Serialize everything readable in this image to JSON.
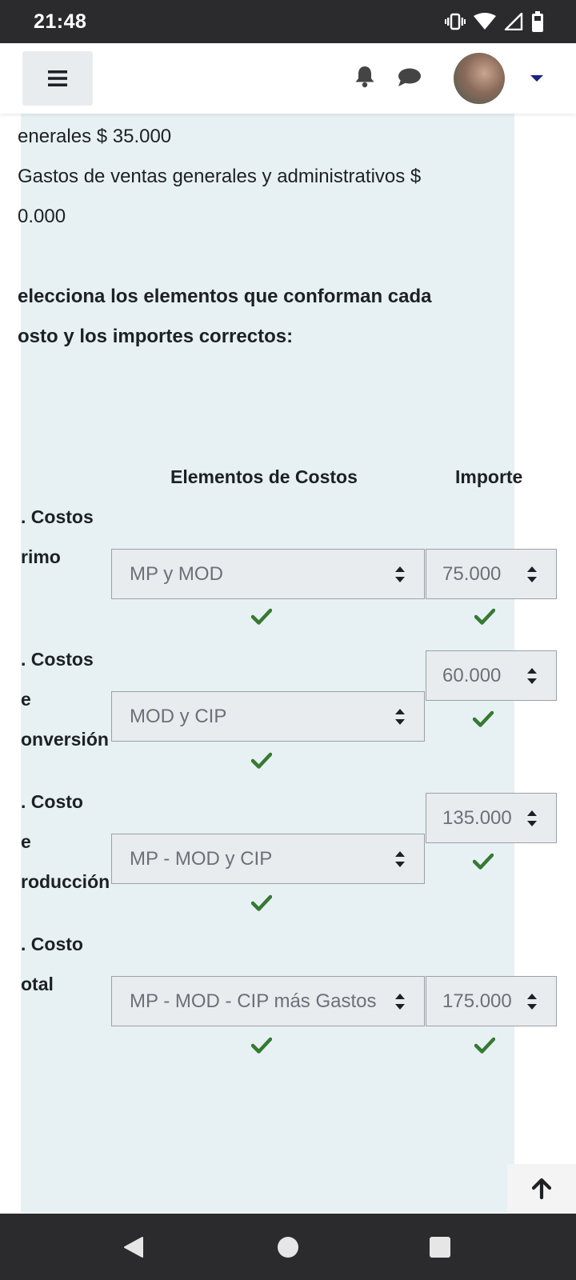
{
  "status_bar": {
    "time": "21:48",
    "icons": [
      "vibrate-icon",
      "wifi-icon",
      "signal-icon",
      "battery-icon"
    ]
  },
  "navbar": {
    "menu_icon": "hamburger-icon",
    "notification_icon": "bell-icon",
    "messages_icon": "chat-bubble-icon",
    "user_menu_icon": "caret-down-icon"
  },
  "content": {
    "intro_lines": [
      "enerales $ 35.000",
      "Gastos de ventas generales y administrativos $",
      "0.000"
    ],
    "instruction_lines": [
      "elecciona los elementos que conforman cada",
      "osto y los importes correctos:"
    ],
    "headers": {
      "elements": "Elementos de Costos",
      "amount": "Importe"
    },
    "rows": [
      {
        "label_lines": [
          ". Costos",
          "rimo"
        ],
        "element_value": "MP y MOD",
        "amount_value": "75.000",
        "element_correct": true,
        "amount_correct": true
      },
      {
        "label_lines": [
          ". Costos",
          "e",
          "onversión"
        ],
        "element_value": "MOD y CIP",
        "amount_value": "60.000",
        "element_correct": true,
        "amount_correct": true
      },
      {
        "label_lines": [
          ". Costo",
          "e",
          "roducción"
        ],
        "element_value": "MP - MOD y CIP",
        "amount_value": "135.000",
        "element_correct": true,
        "amount_correct": true
      },
      {
        "label_lines": [
          ". Costo",
          "otal"
        ],
        "element_value": "MP - MOD - CIP más Gastos",
        "amount_value": "175.000",
        "element_correct": true,
        "amount_correct": true
      }
    ]
  },
  "scroll_top_icon": "arrow-up-icon",
  "system_nav": {
    "back_icon": "back-triangle-icon",
    "home_icon": "home-circle-icon",
    "recents_icon": "recents-square-icon"
  },
  "colors": {
    "panel_bg": "#e7f1f4",
    "check_green": "#357a32",
    "select_bg": "#e9ecef",
    "caret_blue": "#1a237e",
    "system_bar": "#2b2b2e"
  }
}
